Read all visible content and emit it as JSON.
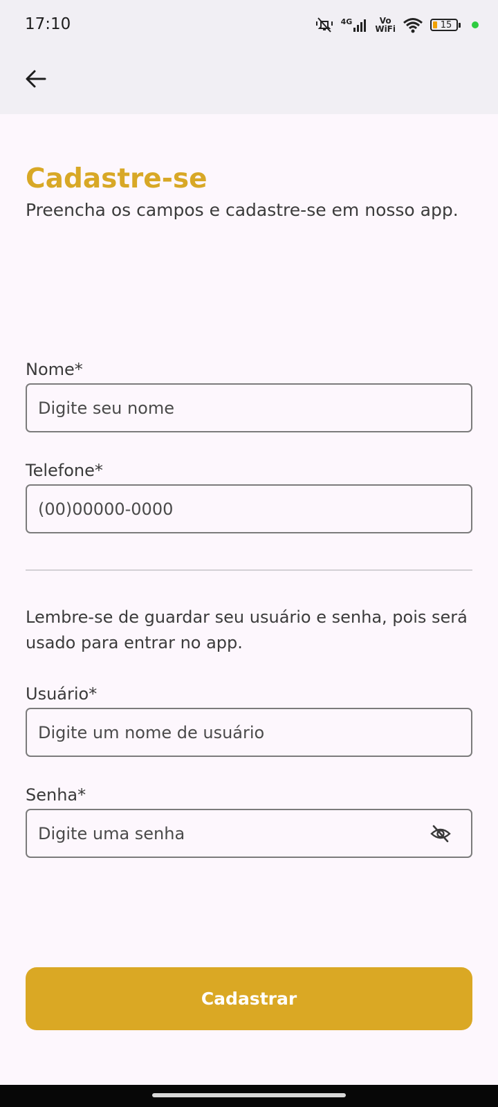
{
  "status_bar": {
    "time": "17:10",
    "network_label": "4G",
    "vo_label": "Vo",
    "wifi_label": "WiFi",
    "battery_level": "15",
    "icons": [
      "mute-icon",
      "signal-icon",
      "wifi-icon",
      "battery-icon",
      "active-dot-icon"
    ],
    "dot_color": "#2ecc40"
  },
  "app_bar": {
    "back_icon": "arrow-left-icon"
  },
  "header": {
    "title": "Cadastre-se",
    "subtitle": "Preencha os campos e cadastre-se em nosso app."
  },
  "form": {
    "name": {
      "label": "Nome*",
      "placeholder": "Digite seu nome",
      "value": ""
    },
    "phone": {
      "label": "Telefone*",
      "placeholder": "(00)00000-0000",
      "value": ""
    },
    "note": "Lembre-se de guardar seu usuário e senha, pois será usado para entrar no app.",
    "username": {
      "label": "Usuário*",
      "placeholder": "Digite um nome de usuário",
      "value": ""
    },
    "password": {
      "label": "Senha*",
      "placeholder": "Digite uma senha",
      "value": "",
      "toggle_icon": "eye-off-icon"
    },
    "submit_label": "Cadastrar"
  },
  "colors": {
    "accent": "#daa824",
    "title": "#d8a826",
    "background": "#fdf7fd",
    "app_bar": "#f1eff4"
  }
}
